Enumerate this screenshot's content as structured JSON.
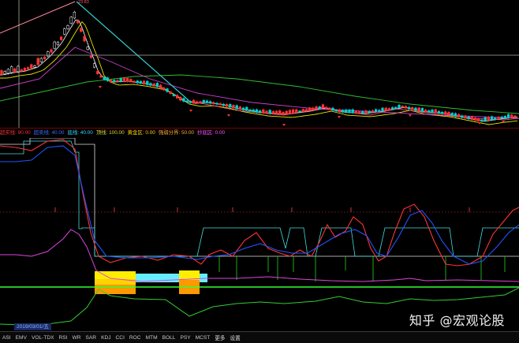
{
  "main": {
    "peak_price_label": "23.83"
  },
  "indicator_header": [
    {
      "label": "超买线: 90.00",
      "color": "#ff3333"
    },
    {
      "label": "超卖线: 40.00",
      "color": "#3a6cff"
    },
    {
      "label": "底线: 40.00",
      "color": "#33ddff"
    },
    {
      "label": "顶线: 100.00",
      "color": "#dddd33"
    },
    {
      "label": "黄金区: 0.00",
      "color": "#ffd700"
    },
    {
      "label": "强弱分界: 50.00",
      "color": "#ffaa33"
    },
    {
      "label": "抄底区: 0.00",
      "color": "#ff55ff"
    }
  ],
  "date_axis": {
    "selected_date": "2019/03/01/五"
  },
  "tabs": [
    "ASI",
    "EMV",
    "VOL-TDX",
    "RSI",
    "WR",
    "SAR",
    "KDJ",
    "CCI",
    "ROC",
    "MTM",
    "BOLL",
    "PSY",
    "MCST",
    "更多",
    "设置"
  ],
  "watermark": "知乎 @宏观论股",
  "colors": {
    "up_candle": "#ff3333",
    "down_candle": "#00d0d0",
    "ma_white": "#e8e8e8",
    "ma_yellow": "#e6e600",
    "ma_magenta": "#d040d0",
    "ma_green": "#33bb33",
    "trend_red": "#ff6680",
    "trend_cyan": "#33cccc"
  }
}
